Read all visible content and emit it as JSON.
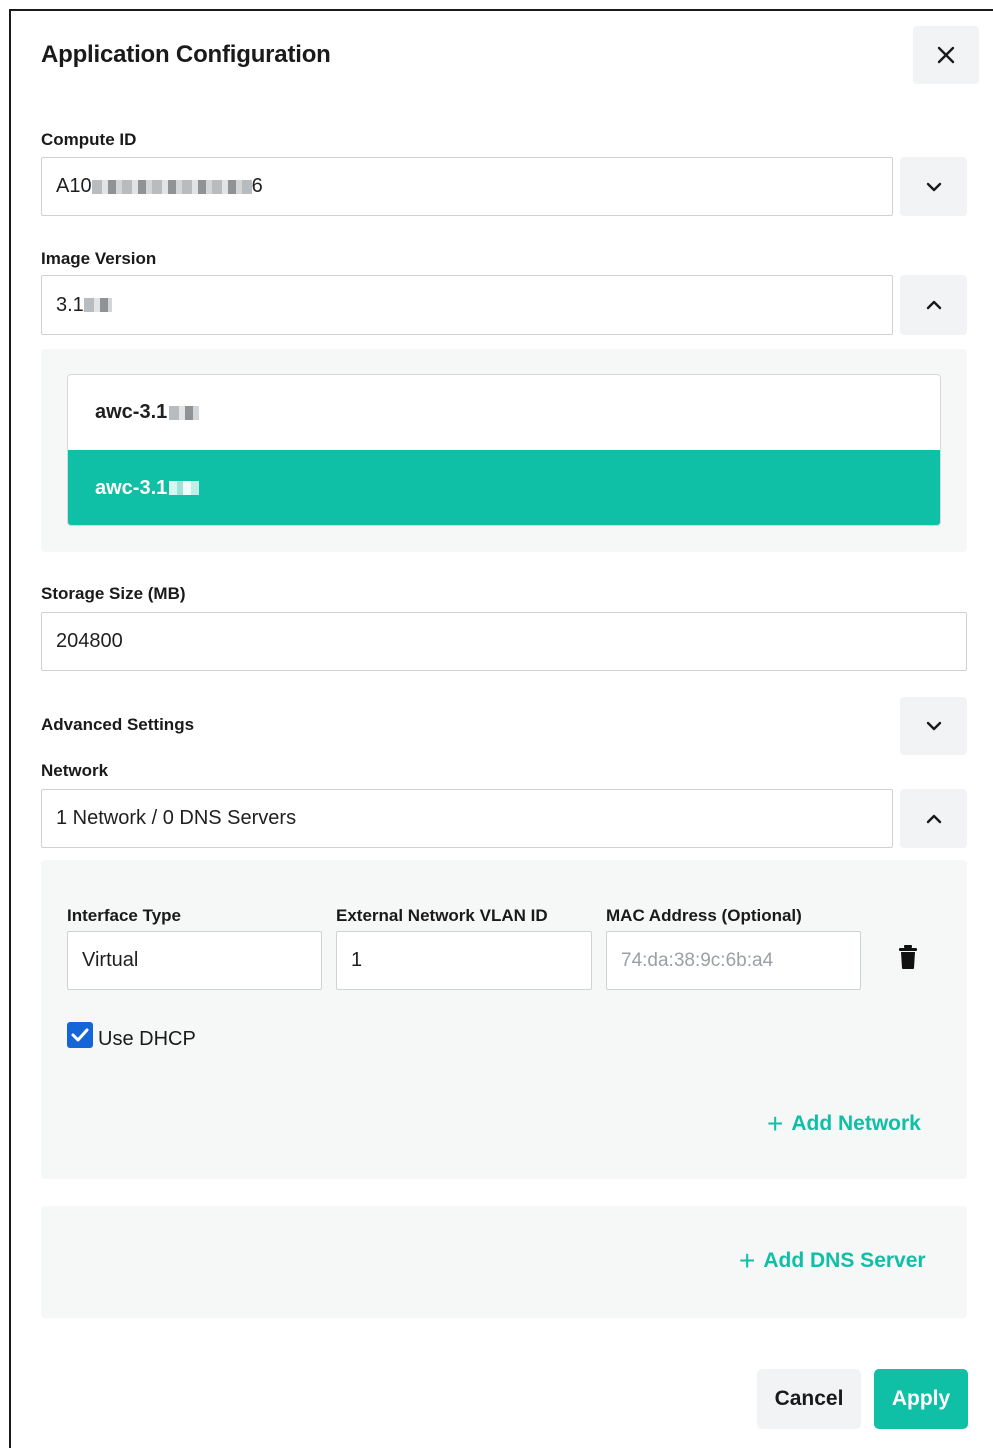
{
  "dialog": {
    "title": "Application Configuration",
    "close_label": "close"
  },
  "compute_id": {
    "label": "Compute ID",
    "value_prefix": "A10",
    "value_suffix": "6"
  },
  "image_version": {
    "label": "Image Version",
    "value_prefix": "3.1",
    "options": [
      {
        "label_prefix": "awc-3.1",
        "selected": false
      },
      {
        "label_prefix": "awc-3.1",
        "selected": true
      }
    ]
  },
  "storage": {
    "label": "Storage Size (MB)",
    "value": "204800"
  },
  "advanced": {
    "label": "Advanced Settings"
  },
  "network": {
    "label": "Network",
    "summary": "1 Network / 0 DNS Servers",
    "interface_type_label": "Interface Type",
    "interface_type_value": "Virtual",
    "vlan_label": "External Network VLAN ID",
    "vlan_value": "1",
    "mac_label": "MAC Address (Optional)",
    "mac_placeholder": "74:da:38:9c:6b:a4",
    "use_dhcp_label": "Use DHCP",
    "use_dhcp_checked": true,
    "add_network_label": "Add Network"
  },
  "dns": {
    "add_dns_label": "Add DNS Server"
  },
  "footer": {
    "cancel_label": "Cancel",
    "apply_label": "Apply"
  },
  "colors": {
    "accent": "#0fbfa6",
    "checkbox": "#1565d8"
  }
}
